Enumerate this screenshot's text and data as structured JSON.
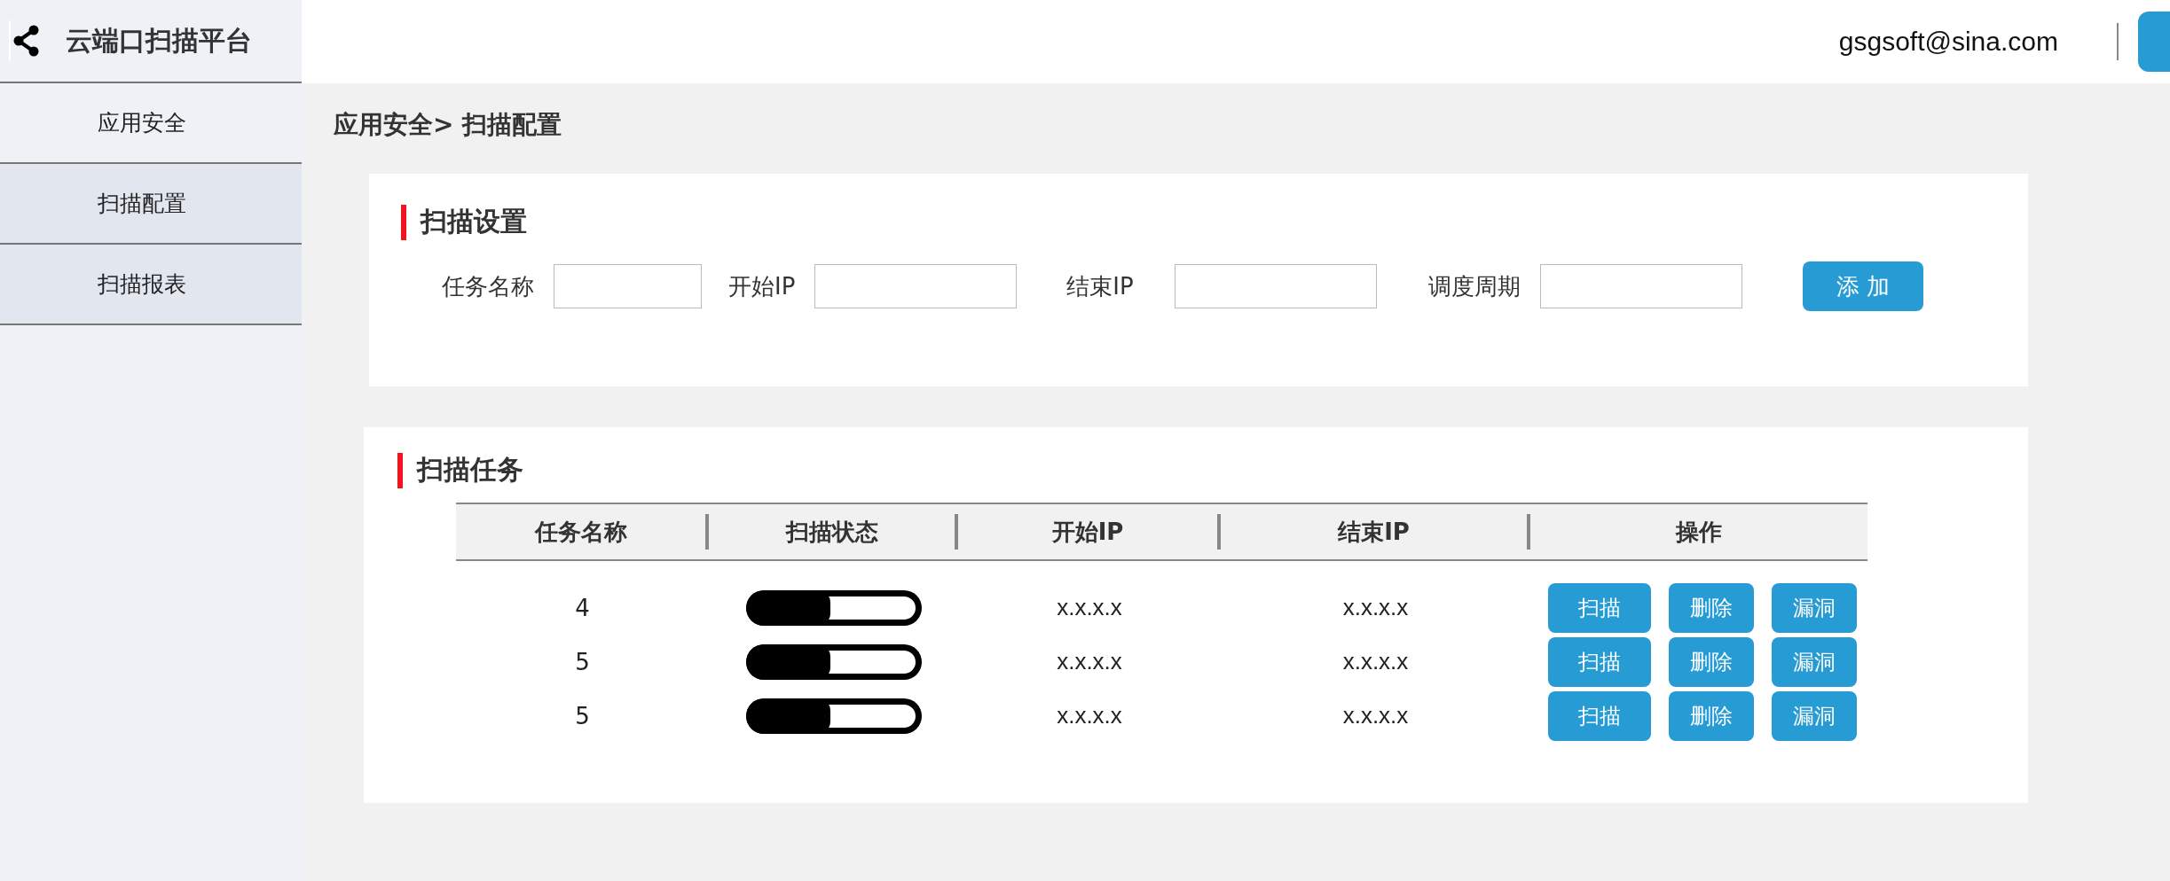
{
  "app": {
    "title": "云端口扫描平台"
  },
  "topbar": {
    "user": "gsgsoft@sina.com"
  },
  "sidebar": {
    "items": [
      {
        "label": "应用安全",
        "kind": "group"
      },
      {
        "label": "扫描配置",
        "kind": "link"
      },
      {
        "label": "扫描报表",
        "kind": "link"
      }
    ]
  },
  "breadcrumb": "应用安全> 扫描配置",
  "settings": {
    "title": "扫描设置",
    "fields": [
      {
        "label": "任务名称"
      },
      {
        "label": "开始IP"
      },
      {
        "label": "结束IP"
      },
      {
        "label": "调度周期"
      }
    ],
    "add_button": "添 加"
  },
  "tasks": {
    "title": "扫描任务",
    "columns": [
      "任务名称",
      "扫描状态",
      "开始IP",
      "结束IP",
      "操作"
    ],
    "rows": [
      {
        "name": "4",
        "level": 0.48,
        "start_ip": "x.x.x.x",
        "end_ip": "x.x.x.x",
        "actions": [
          "扫描",
          "删除",
          "漏洞"
        ]
      },
      {
        "name": "5",
        "level": 0.48,
        "start_ip": "x.x.x.x",
        "end_ip": "x.x.x.x",
        "actions": [
          "扫描",
          "删除",
          "漏洞"
        ]
      },
      {
        "name": "5",
        "level": 0.48,
        "start_ip": "x.x.x.x",
        "end_ip": "x.x.x.x",
        "actions": [
          "扫描",
          "删除",
          "漏洞"
        ]
      }
    ]
  }
}
